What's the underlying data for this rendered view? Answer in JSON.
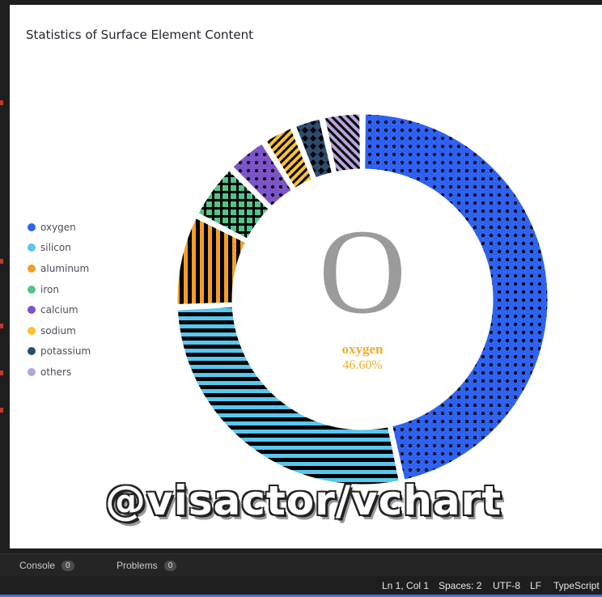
{
  "chart_data": {
    "type": "pie",
    "title": "Statistics of Surface Element Content",
    "categories": [
      "oxygen",
      "silicon",
      "aluminum",
      "iron",
      "calcium",
      "sodium",
      "potassium",
      "others"
    ],
    "values": [
      46.6,
      27.72,
      8.13,
      5.0,
      3.63,
      2.83,
      2.59,
      3.5
    ],
    "colors": [
      "#2e62f0",
      "#59c6ee",
      "#f39e29",
      "#51c58b",
      "#7c55c8",
      "#fbc22f",
      "#2c4c6e",
      "#b7a4dc"
    ],
    "patterns": [
      "dot",
      "horizontal-line",
      "vertical-line",
      "grid",
      "dot",
      "bias-rl",
      "diamond",
      "bias-lr"
    ],
    "legend_position": "left",
    "center": {
      "glyph": "O",
      "label": "oxygen",
      "value": "46.60%"
    }
  },
  "watermark": "@visactor/vchart",
  "panel": {
    "console_label": "Console",
    "console_count": "0",
    "problems_label": "Problems",
    "problems_count": "0"
  },
  "status_bar": {
    "position": "Ln 1, Col 1",
    "spaces": "Spaces: 2",
    "encoding": "UTF-8",
    "line_ending": "LF",
    "language": "TypeScript"
  }
}
